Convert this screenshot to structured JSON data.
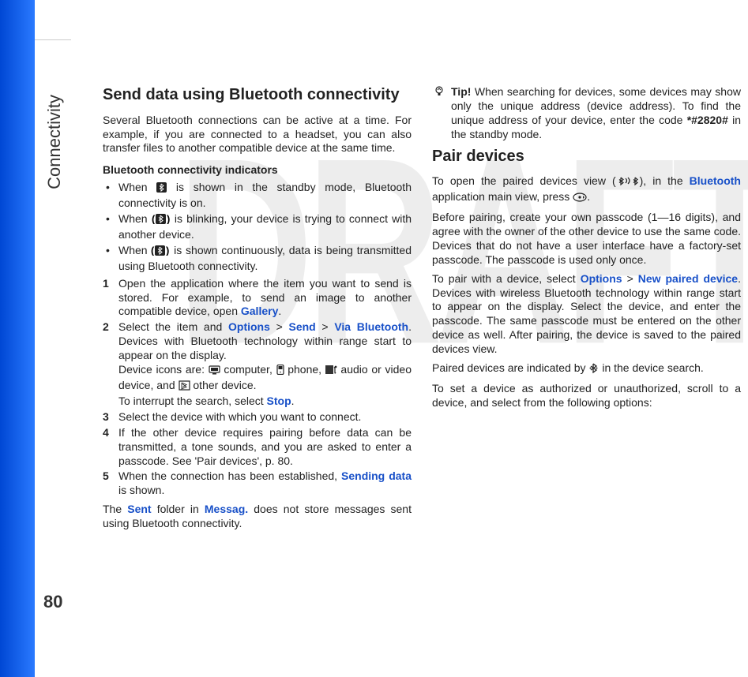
{
  "watermark": "DRAFT",
  "sideLabel": "Connectivity",
  "pageNumber": "80",
  "col1": {
    "h2": "Send data using Bluetooth connectivity",
    "intro": "Several Bluetooth connections can be active at a time. For example, if you are connected to a headset, you can also transfer files to another compatible device at the same time.",
    "h3": "Bluetooth connectivity indicators",
    "b1a": "When ",
    "b1b": " is shown in the standby mode, Bluetooth connectivity is on.",
    "b2a": "When ",
    "b2b": " is blinking, your device is trying to connect with another device.",
    "b3a": "When ",
    "b3b": " is shown continuously, data is being transmitted using Bluetooth connectivity.",
    "s1a": "Open the application where the item you want to send is stored. For example, to send an image to another compatible device, open ",
    "s1b": "Gallery",
    "s1c": ".",
    "s2a": "Select the item and ",
    "s2b": "Options",
    "s2c": " > ",
    "s2d": "Send",
    "s2e": " > ",
    "s2f": "Via Bluetooth",
    "s2g": ". Devices with Bluetooth technology within range start to appear on the display.",
    "s2h1": "Device icons are: ",
    "s2h2": " computer, ",
    "s2h3": " phone, ",
    "s2h4": " audio or video device, and ",
    "s2h5": " other device.",
    "s2i1": "To interrupt the search, select ",
    "s2i2": "Stop",
    "s2i3": ".",
    "s3": "Select the device with which you want to connect.",
    "s4": "If the other device requires pairing before data can be transmitted, a tone sounds, and you are asked to enter a passcode. See 'Pair devices', p. 80."
  },
  "col2": {
    "s5a": "When the connection has been established, ",
    "s5b": "Sending data",
    "s5c": " is shown.",
    "sent1": "The ",
    "sent2": "Sent",
    "sent3": " folder in ",
    "sent4": "Messag.",
    "sent5": " does not store messages sent using Bluetooth connectivity.",
    "tipLabel": "Tip!",
    "tip1": " When searching for devices, some devices may show only the unique address (device address). To find the unique address of your device, enter the code ",
    "tipCode": "*#2820#",
    "tip2": " in the standby mode.",
    "h2": "Pair devices",
    "p1a": "To open the paired devices view (",
    "p1b": "), in the ",
    "p1c": "Bluetooth",
    "p1d": " application main view, press ",
    "p1e": ".",
    "p2": "Before pairing, create your own passcode (1—16 digits), and agree with the owner of the other device to use the same code. Devices that do not have a user interface have a factory-set passcode. The passcode is used only once.",
    "p3a": "To pair with a device, select ",
    "p3b": "Options",
    "p3c": " > ",
    "p3d": "New paired device",
    "p3e": ". Devices with wireless Bluetooth technology within range start to appear on the display. Select the device, and enter the passcode. The same passcode must be entered on the other device as well. After pairing, the device is saved to the paired devices view.",
    "p4a": "Paired devices are indicated by ",
    "p4b": " in the device search.",
    "p5": "To set a device as authorized or unauthorized, scroll to a device, and select from the following options:"
  }
}
